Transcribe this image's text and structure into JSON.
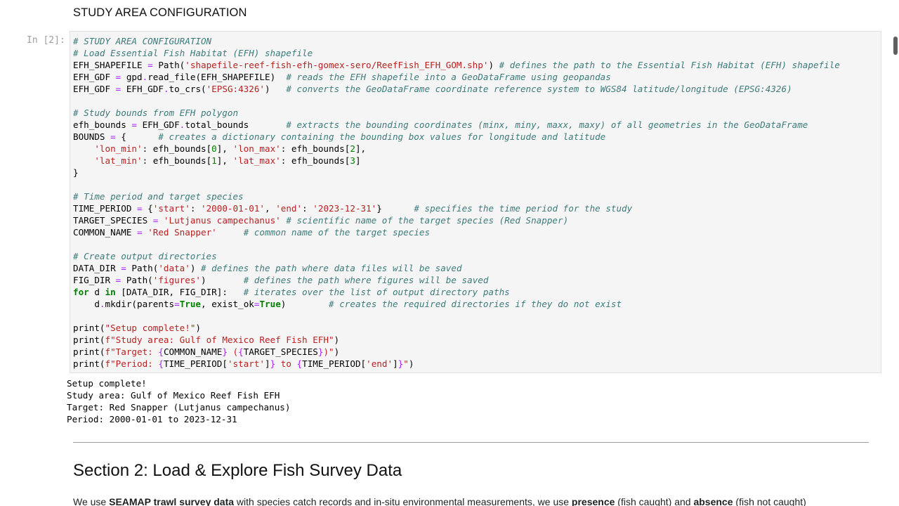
{
  "markdown_heading": "STUDY AREA CONFIGURATION",
  "cell_prompt": "In [2]:",
  "code_lines": [
    [
      {
        "t": "# STUDY AREA CONFIGURATION",
        "c": "com"
      }
    ],
    [
      {
        "t": "# Load Essential Fish Habitat (EFH) shapefile",
        "c": "com"
      }
    ],
    [
      {
        "t": "EFH_SHAPEFILE ",
        "c": "plain"
      },
      {
        "t": "=",
        "c": "op"
      },
      {
        "t": " Path(",
        "c": "plain"
      },
      {
        "t": "'shapefile-reef-fish-efh-gomex-sero/ReefFish_EFH_GOM.shp'",
        "c": "str"
      },
      {
        "t": ") ",
        "c": "plain"
      },
      {
        "t": "# defines the path to the Essential Fish Habitat (EFH) shapefile",
        "c": "com"
      }
    ],
    [
      {
        "t": "EFH_GDF ",
        "c": "plain"
      },
      {
        "t": "=",
        "c": "op"
      },
      {
        "t": " gpd",
        "c": "plain"
      },
      {
        "t": ".",
        "c": "op"
      },
      {
        "t": "read_file(EFH_SHAPEFILE)  ",
        "c": "plain"
      },
      {
        "t": "# reads the EFH shapefile into a GeoDataFrame using geopandas",
        "c": "com"
      }
    ],
    [
      {
        "t": "EFH_GDF ",
        "c": "plain"
      },
      {
        "t": "=",
        "c": "op"
      },
      {
        "t": " EFH_GDF",
        "c": "plain"
      },
      {
        "t": ".",
        "c": "op"
      },
      {
        "t": "to_crs(",
        "c": "plain"
      },
      {
        "t": "'EPSG:4326'",
        "c": "str"
      },
      {
        "t": ")   ",
        "c": "plain"
      },
      {
        "t": "# converts the GeoDataFrame coordinate reference system to WGS84 latitude/longitude (EPSG:4326)",
        "c": "com"
      }
    ],
    [],
    [
      {
        "t": "# Study bounds from EFH polygon",
        "c": "com"
      }
    ],
    [
      {
        "t": "efh_bounds ",
        "c": "plain"
      },
      {
        "t": "=",
        "c": "op"
      },
      {
        "t": " EFH_GDF",
        "c": "plain"
      },
      {
        "t": ".",
        "c": "op"
      },
      {
        "t": "total_bounds       ",
        "c": "plain"
      },
      {
        "t": "# extracts the bounding coordinates (minx, miny, maxx, maxy) of all geometries in the GeoDataFrame",
        "c": "com"
      }
    ],
    [
      {
        "t": "BOUNDS ",
        "c": "plain"
      },
      {
        "t": "=",
        "c": "op"
      },
      {
        "t": " {      ",
        "c": "plain"
      },
      {
        "t": "# creates a dictionary containing the bounding box values for longitude and latitude",
        "c": "com"
      }
    ],
    [
      {
        "t": "    ",
        "c": "plain"
      },
      {
        "t": "'lon_min'",
        "c": "str"
      },
      {
        "t": ": efh_bounds[",
        "c": "plain"
      },
      {
        "t": "0",
        "c": "num"
      },
      {
        "t": "], ",
        "c": "plain"
      },
      {
        "t": "'lon_max'",
        "c": "str"
      },
      {
        "t": ": efh_bounds[",
        "c": "plain"
      },
      {
        "t": "2",
        "c": "num"
      },
      {
        "t": "],",
        "c": "plain"
      }
    ],
    [
      {
        "t": "    ",
        "c": "plain"
      },
      {
        "t": "'lat_min'",
        "c": "str"
      },
      {
        "t": ": efh_bounds[",
        "c": "plain"
      },
      {
        "t": "1",
        "c": "num"
      },
      {
        "t": "], ",
        "c": "plain"
      },
      {
        "t": "'lat_max'",
        "c": "str"
      },
      {
        "t": ": efh_bounds[",
        "c": "plain"
      },
      {
        "t": "3",
        "c": "num"
      },
      {
        "t": "]",
        "c": "plain"
      }
    ],
    [
      {
        "t": "}",
        "c": "plain"
      }
    ],
    [],
    [
      {
        "t": "# Time period and target species",
        "c": "com"
      }
    ],
    [
      {
        "t": "TIME_PERIOD ",
        "c": "plain"
      },
      {
        "t": "=",
        "c": "op"
      },
      {
        "t": " {",
        "c": "plain"
      },
      {
        "t": "'start'",
        "c": "str"
      },
      {
        "t": ": ",
        "c": "plain"
      },
      {
        "t": "'2000-01-01'",
        "c": "str"
      },
      {
        "t": ", ",
        "c": "plain"
      },
      {
        "t": "'end'",
        "c": "str"
      },
      {
        "t": ": ",
        "c": "plain"
      },
      {
        "t": "'2023-12-31'",
        "c": "str"
      },
      {
        "t": "}      ",
        "c": "plain"
      },
      {
        "t": "# specifies the time period for the study",
        "c": "com"
      }
    ],
    [
      {
        "t": "TARGET_SPECIES ",
        "c": "plain"
      },
      {
        "t": "=",
        "c": "op"
      },
      {
        "t": " ",
        "c": "plain"
      },
      {
        "t": "'Lutjanus campechanus'",
        "c": "str"
      },
      {
        "t": " ",
        "c": "plain"
      },
      {
        "t": "# scientific name of the target species (Red Snapper)",
        "c": "com"
      }
    ],
    [
      {
        "t": "COMMON_NAME ",
        "c": "plain"
      },
      {
        "t": "=",
        "c": "op"
      },
      {
        "t": " ",
        "c": "plain"
      },
      {
        "t": "'Red Snapper'",
        "c": "str"
      },
      {
        "t": "     ",
        "c": "plain"
      },
      {
        "t": "# common name of the target species",
        "c": "com"
      }
    ],
    [],
    [
      {
        "t": "# Create output directories",
        "c": "com"
      }
    ],
    [
      {
        "t": "DATA_DIR ",
        "c": "plain"
      },
      {
        "t": "=",
        "c": "op"
      },
      {
        "t": " Path(",
        "c": "plain"
      },
      {
        "t": "'data'",
        "c": "str"
      },
      {
        "t": ") ",
        "c": "plain"
      },
      {
        "t": "# defines the path where data files will be saved",
        "c": "com"
      }
    ],
    [
      {
        "t": "FIG_DIR ",
        "c": "plain"
      },
      {
        "t": "=",
        "c": "op"
      },
      {
        "t": " Path(",
        "c": "plain"
      },
      {
        "t": "'figures'",
        "c": "str"
      },
      {
        "t": ")       ",
        "c": "plain"
      },
      {
        "t": "# defines the path where figures will be saved",
        "c": "com"
      }
    ],
    [
      {
        "t": "for",
        "c": "kw"
      },
      {
        "t": " d ",
        "c": "plain"
      },
      {
        "t": "in",
        "c": "kw"
      },
      {
        "t": " [DATA_DIR, FIG_DIR]:   ",
        "c": "plain"
      },
      {
        "t": "# iterates over the list of output directory paths",
        "c": "com"
      }
    ],
    [
      {
        "t": "    d",
        "c": "plain"
      },
      {
        "t": ".",
        "c": "op"
      },
      {
        "t": "mkdir(parents",
        "c": "plain"
      },
      {
        "t": "=",
        "c": "op"
      },
      {
        "t": "True",
        "c": "kw"
      },
      {
        "t": ", exist_ok",
        "c": "plain"
      },
      {
        "t": "=",
        "c": "op"
      },
      {
        "t": "True",
        "c": "kw"
      },
      {
        "t": ")        ",
        "c": "plain"
      },
      {
        "t": "# creates the required directories if they do not exist",
        "c": "com"
      }
    ],
    [],
    [
      {
        "t": "print",
        "c": "plain"
      },
      {
        "t": "(",
        "c": "plain"
      },
      {
        "t": "\"Setup complete!\"",
        "c": "str"
      },
      {
        "t": ")",
        "c": "plain"
      }
    ],
    [
      {
        "t": "print",
        "c": "plain"
      },
      {
        "t": "(",
        "c": "plain"
      },
      {
        "t": "f\"Study area: Gulf of Mexico Reef Fish EFH\"",
        "c": "str"
      },
      {
        "t": ")",
        "c": "plain"
      }
    ],
    [
      {
        "t": "print",
        "c": "plain"
      },
      {
        "t": "(",
        "c": "plain"
      },
      {
        "t": "f\"Target: ",
        "c": "str"
      },
      {
        "t": "{",
        "c": "op"
      },
      {
        "t": "COMMON_NAME",
        "c": "plain"
      },
      {
        "t": "}",
        "c": "op"
      },
      {
        "t": " (",
        "c": "str"
      },
      {
        "t": "{",
        "c": "op"
      },
      {
        "t": "TARGET_SPECIES",
        "c": "plain"
      },
      {
        "t": "}",
        "c": "op"
      },
      {
        "t": ")\"",
        "c": "str"
      },
      {
        "t": ")",
        "c": "plain"
      }
    ],
    [
      {
        "t": "print",
        "c": "plain"
      },
      {
        "t": "(",
        "c": "plain"
      },
      {
        "t": "f\"Period: ",
        "c": "str"
      },
      {
        "t": "{",
        "c": "op"
      },
      {
        "t": "TIME_PERIOD[",
        "c": "plain"
      },
      {
        "t": "'start'",
        "c": "str"
      },
      {
        "t": "]",
        "c": "plain"
      },
      {
        "t": "}",
        "c": "op"
      },
      {
        "t": " to ",
        "c": "str"
      },
      {
        "t": "{",
        "c": "op"
      },
      {
        "t": "TIME_PERIOD[",
        "c": "plain"
      },
      {
        "t": "'end'",
        "c": "str"
      },
      {
        "t": "]",
        "c": "plain"
      },
      {
        "t": "}",
        "c": "op"
      },
      {
        "t": "\"",
        "c": "str"
      },
      {
        "t": ")",
        "c": "plain"
      }
    ]
  ],
  "output_lines": [
    "Setup complete!",
    "Study area: Gulf of Mexico Reef Fish EFH",
    "Target: Red Snapper (Lutjanus campechanus)",
    "Period: 2000-01-01 to 2023-12-31"
  ],
  "section_title": "Section 2: Load & Explore Fish Survey Data",
  "paragraph": [
    {
      "t": "We use ",
      "b": false
    },
    {
      "t": "SEAMAP trawl survey data",
      "b": true
    },
    {
      "t": " with species catch records and in-situ environmental measurements, we use ",
      "b": false
    },
    {
      "t": "presence",
      "b": true
    },
    {
      "t": " (fish caught) and ",
      "b": false
    },
    {
      "t": "absence",
      "b": true
    },
    {
      "t": " (fish not caught)",
      "b": false
    }
  ]
}
